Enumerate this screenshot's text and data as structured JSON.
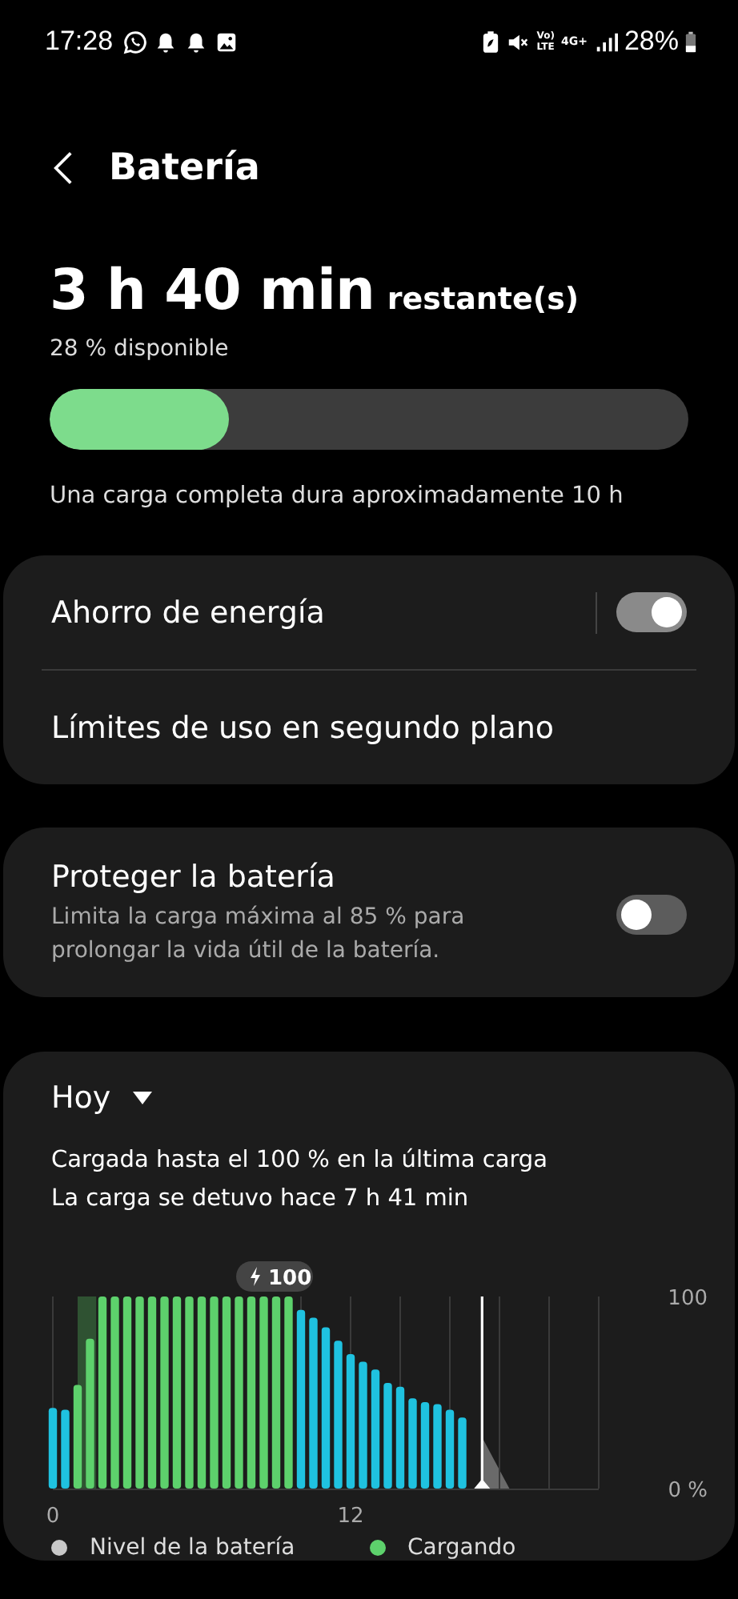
{
  "status_bar": {
    "time": "17:28",
    "volte": "Vo)",
    "lte": "LTE",
    "network": "4G+",
    "battery": "28%"
  },
  "header": {
    "title": "Batería"
  },
  "summary": {
    "remaining": "3 h 40 min",
    "remaining_suffix": "restante(s)",
    "available": "28 % disponible",
    "level": 0.28,
    "note": "Una carga completa dura aproximadamente 10 h"
  },
  "settings_group": [
    {
      "kind": "toggle",
      "label": "Ahorro de energía",
      "on": true
    },
    {
      "kind": "link",
      "label": "Límites de uso en segundo plano"
    }
  ],
  "protect": {
    "title": "Proteger la batería",
    "description": "Limita la carga máxima al 85 % para prolongar la vida útil de la batería.",
    "on": false
  },
  "usage": {
    "period": "Hoy",
    "lines": [
      "Cargada hasta el 100 % en la última carga",
      "La carga se detuvo hace 7 h 41 min"
    ],
    "charge_badge": "100",
    "chart_data": {
      "type": "bar",
      "xlim": [
        0,
        22
      ],
      "x": [
        0,
        0.5,
        1,
        1.5,
        2,
        2.5,
        3,
        3.5,
        4,
        4.5,
        5,
        5.5,
        6,
        6.5,
        7,
        7.5,
        8,
        8.5,
        9,
        9.5,
        10,
        10.5,
        11,
        11.5,
        12,
        12.5,
        13,
        13.5,
        14,
        14.5,
        15,
        15.5,
        16,
        16.5
      ],
      "ylim": [
        0,
        100
      ],
      "xticks": [
        {
          "value": 0,
          "label": "0"
        },
        {
          "value": 12,
          "label": "12"
        }
      ],
      "yticks": [
        {
          "value": 0,
          "label": "0 %"
        },
        {
          "value": 100,
          "label": "100"
        }
      ],
      "series": [
        {
          "name": "Nivel de la batería",
          "color": "#1fc2e0",
          "values": [
            42,
            41,
            null,
            null,
            null,
            null,
            null,
            null,
            null,
            null,
            null,
            null,
            null,
            null,
            null,
            null,
            null,
            null,
            null,
            null,
            93,
            89,
            84,
            77,
            70,
            66,
            62,
            55,
            53,
            47,
            45,
            44,
            41,
            37
          ]
        },
        {
          "name": "Cargando",
          "color": "#5dd16c",
          "values": [
            null,
            null,
            54,
            78,
            100,
            100,
            100,
            100,
            100,
            100,
            100,
            100,
            100,
            100,
            100,
            100,
            100,
            100,
            100,
            100,
            null,
            null,
            null,
            null,
            null,
            null,
            null,
            null,
            null,
            null,
            null,
            null,
            null,
            null
          ]
        }
      ]
    },
    "legend": [
      {
        "color": "#c8c8c8"
      },
      {
        "color": "#5dd16c"
      }
    ]
  }
}
